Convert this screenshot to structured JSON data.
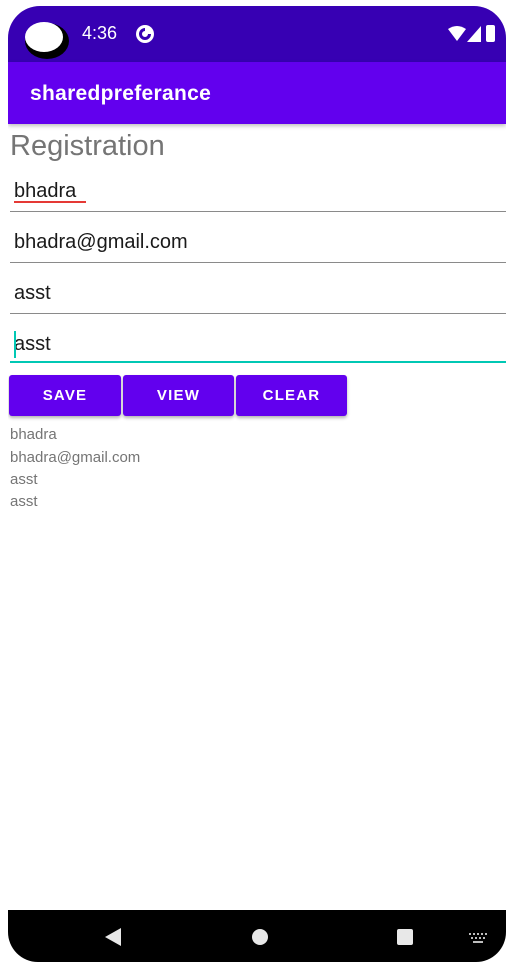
{
  "status_bar": {
    "time": "4:36",
    "icons": [
      "sync-icon",
      "wifi-icon",
      "signal-icon",
      "battery-icon"
    ]
  },
  "app_bar": {
    "title": "sharedpreferance"
  },
  "form": {
    "heading": "Registration",
    "fields": [
      {
        "value": "bhadra"
      },
      {
        "value": "bhadra@gmail.com"
      },
      {
        "value": "asst"
      },
      {
        "value": "asst"
      }
    ]
  },
  "buttons": {
    "save": "SAVE",
    "view": "VIEW",
    "clear": "CLEAR"
  },
  "output": {
    "lines": [
      "bhadra",
      "bhadra@gmail.com",
      "asst",
      "asst"
    ]
  },
  "nav_bar": {
    "icons": [
      "back-icon",
      "home-icon",
      "recent-apps-icon",
      "keyboard-icon"
    ]
  },
  "colors": {
    "status_bar": "#3700b3",
    "primary": "#6200ee",
    "accent": "#00c8b4",
    "spell_error": "#e53935"
  }
}
